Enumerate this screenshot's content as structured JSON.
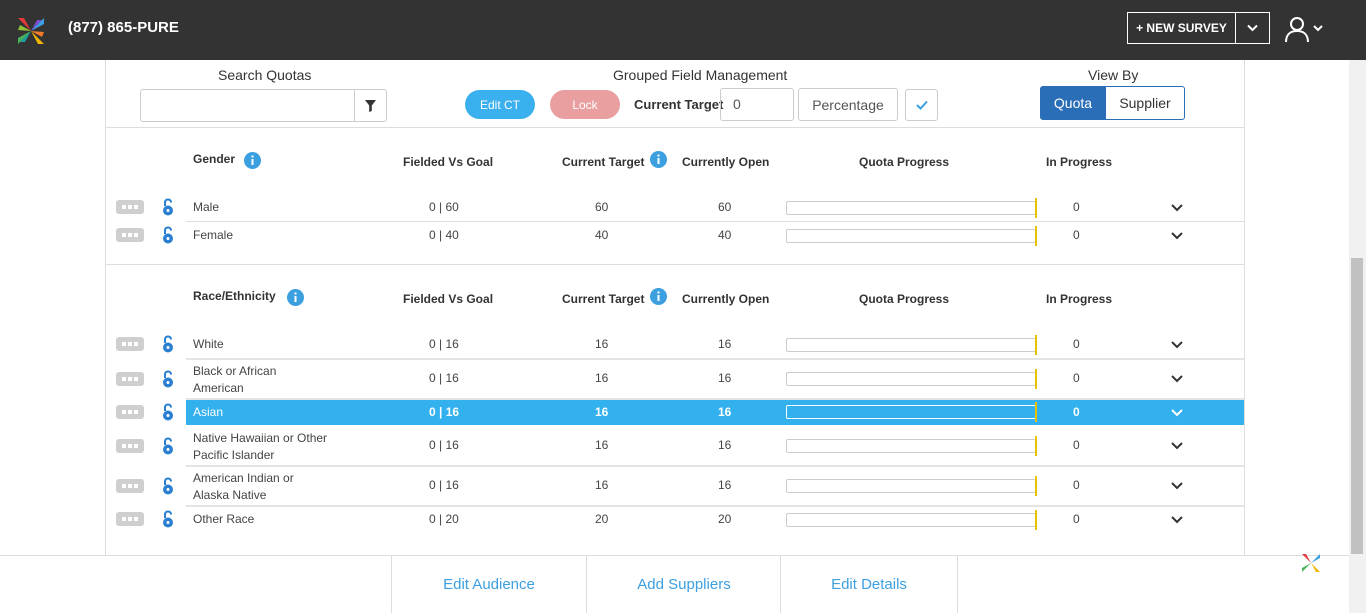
{
  "header": {
    "phone": "(877) 865-PURE",
    "new_survey_label": "+ NEW SURVEY",
    "icons": [
      "logo-icon",
      "chevron-down-icon",
      "user-icon"
    ]
  },
  "toolbar": {
    "search_label": "Search Quotas",
    "search_value": "",
    "group_label": "Grouped Field Management",
    "edit_ct_label": "Edit CT",
    "lock_label": "Lock",
    "current_target_label": "Current Target",
    "current_target_value": "0",
    "percentage_label": "Percentage",
    "view_by_label": "View By",
    "view_by_options": [
      "Quota",
      "Supplier"
    ],
    "view_by_selected": "Quota"
  },
  "columns": {
    "fielded": "Fielded Vs Goal",
    "current_target": "Current Target",
    "currently_open": "Currently Open",
    "quota_progress": "Quota Progress",
    "in_progress": "In Progress"
  },
  "groups": [
    {
      "name": "Gender",
      "rows": [
        {
          "label": "Male",
          "fielded": "0 | 60",
          "target": "60",
          "open": "60",
          "progress": 0,
          "in_progress": "0"
        },
        {
          "label": "Female",
          "fielded": "0 | 40",
          "target": "40",
          "open": "40",
          "progress": 0,
          "in_progress": "0"
        }
      ]
    },
    {
      "name": "Race/Ethnicity",
      "rows": [
        {
          "label": "White",
          "fielded": "0 | 16",
          "target": "16",
          "open": "16",
          "progress": 0,
          "in_progress": "0"
        },
        {
          "label": "Black or African American",
          "fielded": "0 | 16",
          "target": "16",
          "open": "16",
          "progress": 0,
          "in_progress": "0"
        },
        {
          "label": "Asian",
          "fielded": "0 | 16",
          "target": "16",
          "open": "16",
          "progress": 0,
          "in_progress": "0",
          "selected": true
        },
        {
          "label": "Native Hawaiian or Other Pacific Islander",
          "fielded": "0 | 16",
          "target": "16",
          "open": "16",
          "progress": 0,
          "in_progress": "0"
        },
        {
          "label": "American Indian or Alaska Native",
          "fielded": "0 | 16",
          "target": "16",
          "open": "16",
          "progress": 0,
          "in_progress": "0"
        },
        {
          "label": "Other Race",
          "fielded": "0 | 20",
          "target": "20",
          "open": "20",
          "progress": 0,
          "in_progress": "0"
        }
      ]
    }
  ],
  "footer": {
    "edit_audience": "Edit Audience",
    "add_suppliers": "Add Suppliers",
    "edit_details": "Edit Details"
  },
  "colors": {
    "topbar": "#333333",
    "accent_blue": "#33b0ee",
    "selected_view": "#2a6eb8",
    "lock_pill": "#e99f9f",
    "progress_marker": "#e6c200",
    "footer_link": "#3b9fe0"
  }
}
